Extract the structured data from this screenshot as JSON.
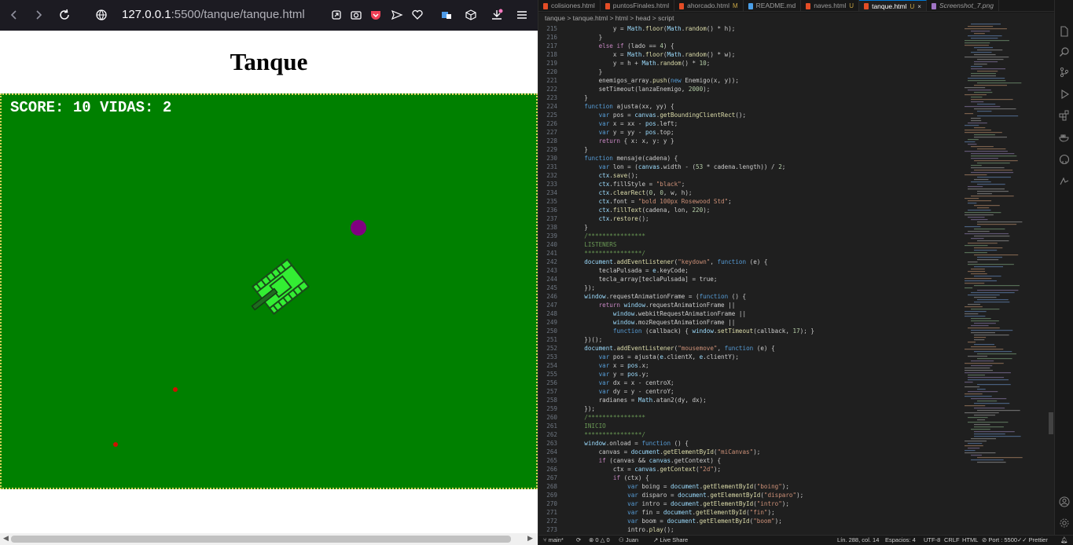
{
  "browser": {
    "url_host": "127.0.0.1",
    "url_path": ":5500/tanque/tanque.html",
    "page_heading": "Tanque",
    "score_text": "SCORE: 10 VIDAS: 2",
    "colors": {
      "canvas_green": "#008000",
      "enemy": "#800080",
      "bullet": "#cc0000",
      "tank": "#33ee33"
    }
  },
  "editor": {
    "tabs": [
      {
        "label": "colisiones.html",
        "modified": "",
        "active": false
      },
      {
        "label": "puntosFinales.html",
        "modified": "",
        "active": false
      },
      {
        "label": "ahorcado.html",
        "modified": "M",
        "active": false
      },
      {
        "label": "README.md",
        "modified": "",
        "active": false
      },
      {
        "label": "naves.html",
        "modified": "U",
        "active": false
      },
      {
        "label": "tanque.html",
        "modified": "U",
        "active": true
      },
      {
        "label": "Screenshot_7.png",
        "modified": "",
        "active": false
      }
    ],
    "breadcrumb": "tanque  >  tanque.html  >  html  >  head  >  script",
    "code_lines": [
      {
        "n": "215",
        "t": "            y = Math.floor(Math.random() * h);"
      },
      {
        "n": "216",
        "t": "        }"
      },
      {
        "n": "217",
        "t": "        else if (lado == 4) {"
      },
      {
        "n": "218",
        "t": "            x = Math.floor(Math.random() * w);"
      },
      {
        "n": "219",
        "t": "            y = h + Math.random() * 10;"
      },
      {
        "n": "220",
        "t": "        }"
      },
      {
        "n": "221",
        "t": "        enemigos_array.push(new Enemigo(x, y));"
      },
      {
        "n": "222",
        "t": "        setTimeout(lanzaEnemigo, 2000);"
      },
      {
        "n": "223",
        "t": "    }"
      },
      {
        "n": "224",
        "t": "    function ajusta(xx, yy) {"
      },
      {
        "n": "225",
        "t": "        var pos = canvas.getBoundingClientRect();"
      },
      {
        "n": "226",
        "t": "        var x = xx - pos.left;"
      },
      {
        "n": "227",
        "t": "        var y = yy - pos.top;"
      },
      {
        "n": "228",
        "t": "        return { x: x, y: y }"
      },
      {
        "n": "229",
        "t": "    }"
      },
      {
        "n": "230",
        "t": "    function mensaje(cadena) {"
      },
      {
        "n": "231",
        "t": "        var lon = (canvas.width - (53 * cadena.length)) / 2;"
      },
      {
        "n": "232",
        "t": "        ctx.save();"
      },
      {
        "n": "233",
        "t": "        ctx.fillStyle = \"black\";"
      },
      {
        "n": "234",
        "t": "        ctx.clearRect(0, 0, w, h);"
      },
      {
        "n": "235",
        "t": "        ctx.font = \"bold 100px Rosewood Std\";"
      },
      {
        "n": "236",
        "t": "        ctx.fillText(cadena, lon, 220);"
      },
      {
        "n": "237",
        "t": "        ctx.restore();"
      },
      {
        "n": "238",
        "t": "    }"
      },
      {
        "n": "239",
        "t": "    /****************"
      },
      {
        "n": "240",
        "t": "    LISTENERS"
      },
      {
        "n": "241",
        "t": "    ****************/"
      },
      {
        "n": "242",
        "t": "    document.addEventListener(\"keydown\", function (e) {"
      },
      {
        "n": "243",
        "t": "        teclaPulsada = e.keyCode;"
      },
      {
        "n": "244",
        "t": "        tecla_array[teclaPulsada] = true;"
      },
      {
        "n": "245",
        "t": "    });"
      },
      {
        "n": "246",
        "t": "    window.requestAnimationFrame = (function () {"
      },
      {
        "n": "247",
        "t": "        return window.requestAnimationFrame ||"
      },
      {
        "n": "248",
        "t": "            window.webkitRequestAnimationFrame ||"
      },
      {
        "n": "249",
        "t": "            window.mozRequestAnimationFrame ||"
      },
      {
        "n": "250",
        "t": "            function (callback) { window.setTimeout(callback, 17); }"
      },
      {
        "n": "251",
        "t": "    })();"
      },
      {
        "n": "252",
        "t": "    document.addEventListener(\"mousemove\", function (e) {"
      },
      {
        "n": "253",
        "t": "        var pos = ajusta(e.clientX, e.clientY);"
      },
      {
        "n": "254",
        "t": "        var x = pos.x;"
      },
      {
        "n": "255",
        "t": "        var y = pos.y;"
      },
      {
        "n": "256",
        "t": "        var dx = x - centroX;"
      },
      {
        "n": "257",
        "t": "        var dy = y - centroY;"
      },
      {
        "n": "258",
        "t": "        radianes = Math.atan2(dy, dx);"
      },
      {
        "n": "259",
        "t": "    });"
      },
      {
        "n": "260",
        "t": "    /****************"
      },
      {
        "n": "261",
        "t": "    INICIO"
      },
      {
        "n": "262",
        "t": "    ****************/"
      },
      {
        "n": "263",
        "t": "    window.onload = function () {"
      },
      {
        "n": "264",
        "t": "        canvas = document.getElementById(\"miCanvas\");"
      },
      {
        "n": "265",
        "t": "        if (canvas && canvas.getContext) {"
      },
      {
        "n": "266",
        "t": "            ctx = canvas.getContext(\"2d\");"
      },
      {
        "n": "267",
        "t": "            if (ctx) {"
      },
      {
        "n": "268",
        "t": "                var boing = document.getElementById(\"boing\");"
      },
      {
        "n": "269",
        "t": "                var disparo = document.getElementById(\"disparo\");"
      },
      {
        "n": "270",
        "t": "                var intro = document.getElementById(\"intro\");"
      },
      {
        "n": "271",
        "t": "                var fin = document.getElementById(\"fin\");"
      },
      {
        "n": "272",
        "t": "                var boom = document.getElementById(\"boom\");"
      },
      {
        "n": "273",
        "t": "                intro.play();"
      }
    ],
    "status": {
      "branch": "main*",
      "errors": "0",
      "warnings": "0",
      "user": "Juan",
      "live_share": "Live Share",
      "position": "Lín. 288, col. 14",
      "spaces": "Espacios: 4",
      "encoding": "UTF-8",
      "eol": "CRLF",
      "language": "HTML",
      "port": "Port : 5500",
      "formatter": "Prettier"
    }
  }
}
